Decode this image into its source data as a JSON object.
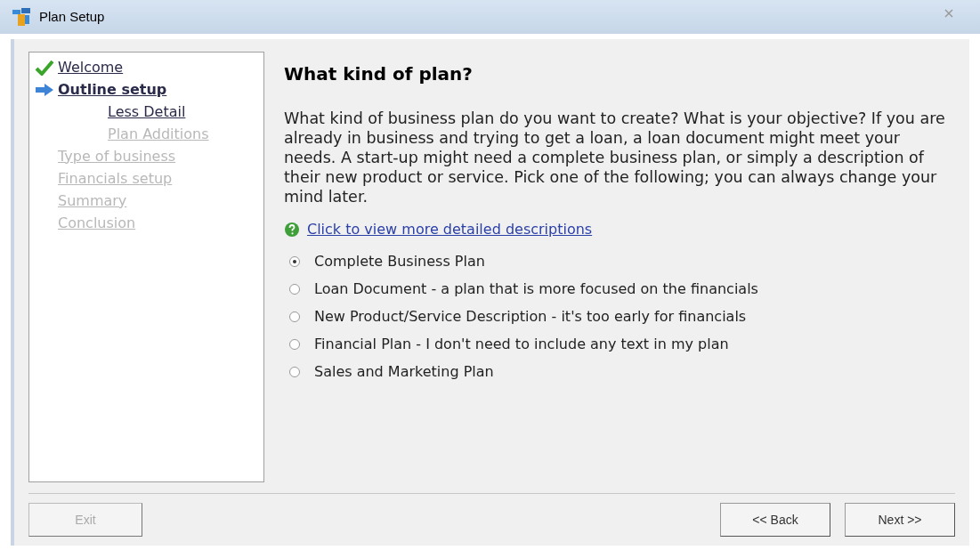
{
  "window": {
    "title": "Plan Setup"
  },
  "steps": [
    {
      "label": "Welcome",
      "done": true,
      "selected": false,
      "disabled": false
    },
    {
      "label": "Outline setup",
      "done": false,
      "selected": true,
      "disabled": false,
      "children": [
        {
          "label": "Less Detail",
          "disabled": false
        },
        {
          "label": "Plan Additions",
          "disabled": true
        }
      ]
    },
    {
      "label": "Type of business",
      "done": false,
      "selected": false,
      "disabled": true
    },
    {
      "label": "Financials setup",
      "done": false,
      "selected": false,
      "disabled": true
    },
    {
      "label": "Summary",
      "done": false,
      "selected": false,
      "disabled": true
    },
    {
      "label": "Conclusion",
      "done": false,
      "selected": false,
      "disabled": true
    }
  ],
  "page": {
    "heading": "What kind of plan?",
    "description": "What kind of business plan do you want to create? What is your objective? If you are already in business and trying to get a loan, a loan document might meet your needs. A start-up might need a complete business plan, or simply a description of their new product or service. Pick one of the following; you can always change your mind later.",
    "help_link": "Click to view more detailed descriptions",
    "options": [
      {
        "label": "Complete Business Plan",
        "selected": true
      },
      {
        "label": "Loan Document - a plan that is more focused on the financials",
        "selected": false
      },
      {
        "label": "New Product/Service Description - it's too early for financials",
        "selected": false
      },
      {
        "label": "Financial Plan - I don't need to include any text in my plan",
        "selected": false
      },
      {
        "label": "Sales and Marketing Plan",
        "selected": false
      }
    ]
  },
  "buttons": [
    {
      "label": "Exit",
      "disabled": true
    },
    {
      "label": "<< Back",
      "disabled": false
    },
    {
      "label": "Next >>",
      "disabled": false
    }
  ]
}
